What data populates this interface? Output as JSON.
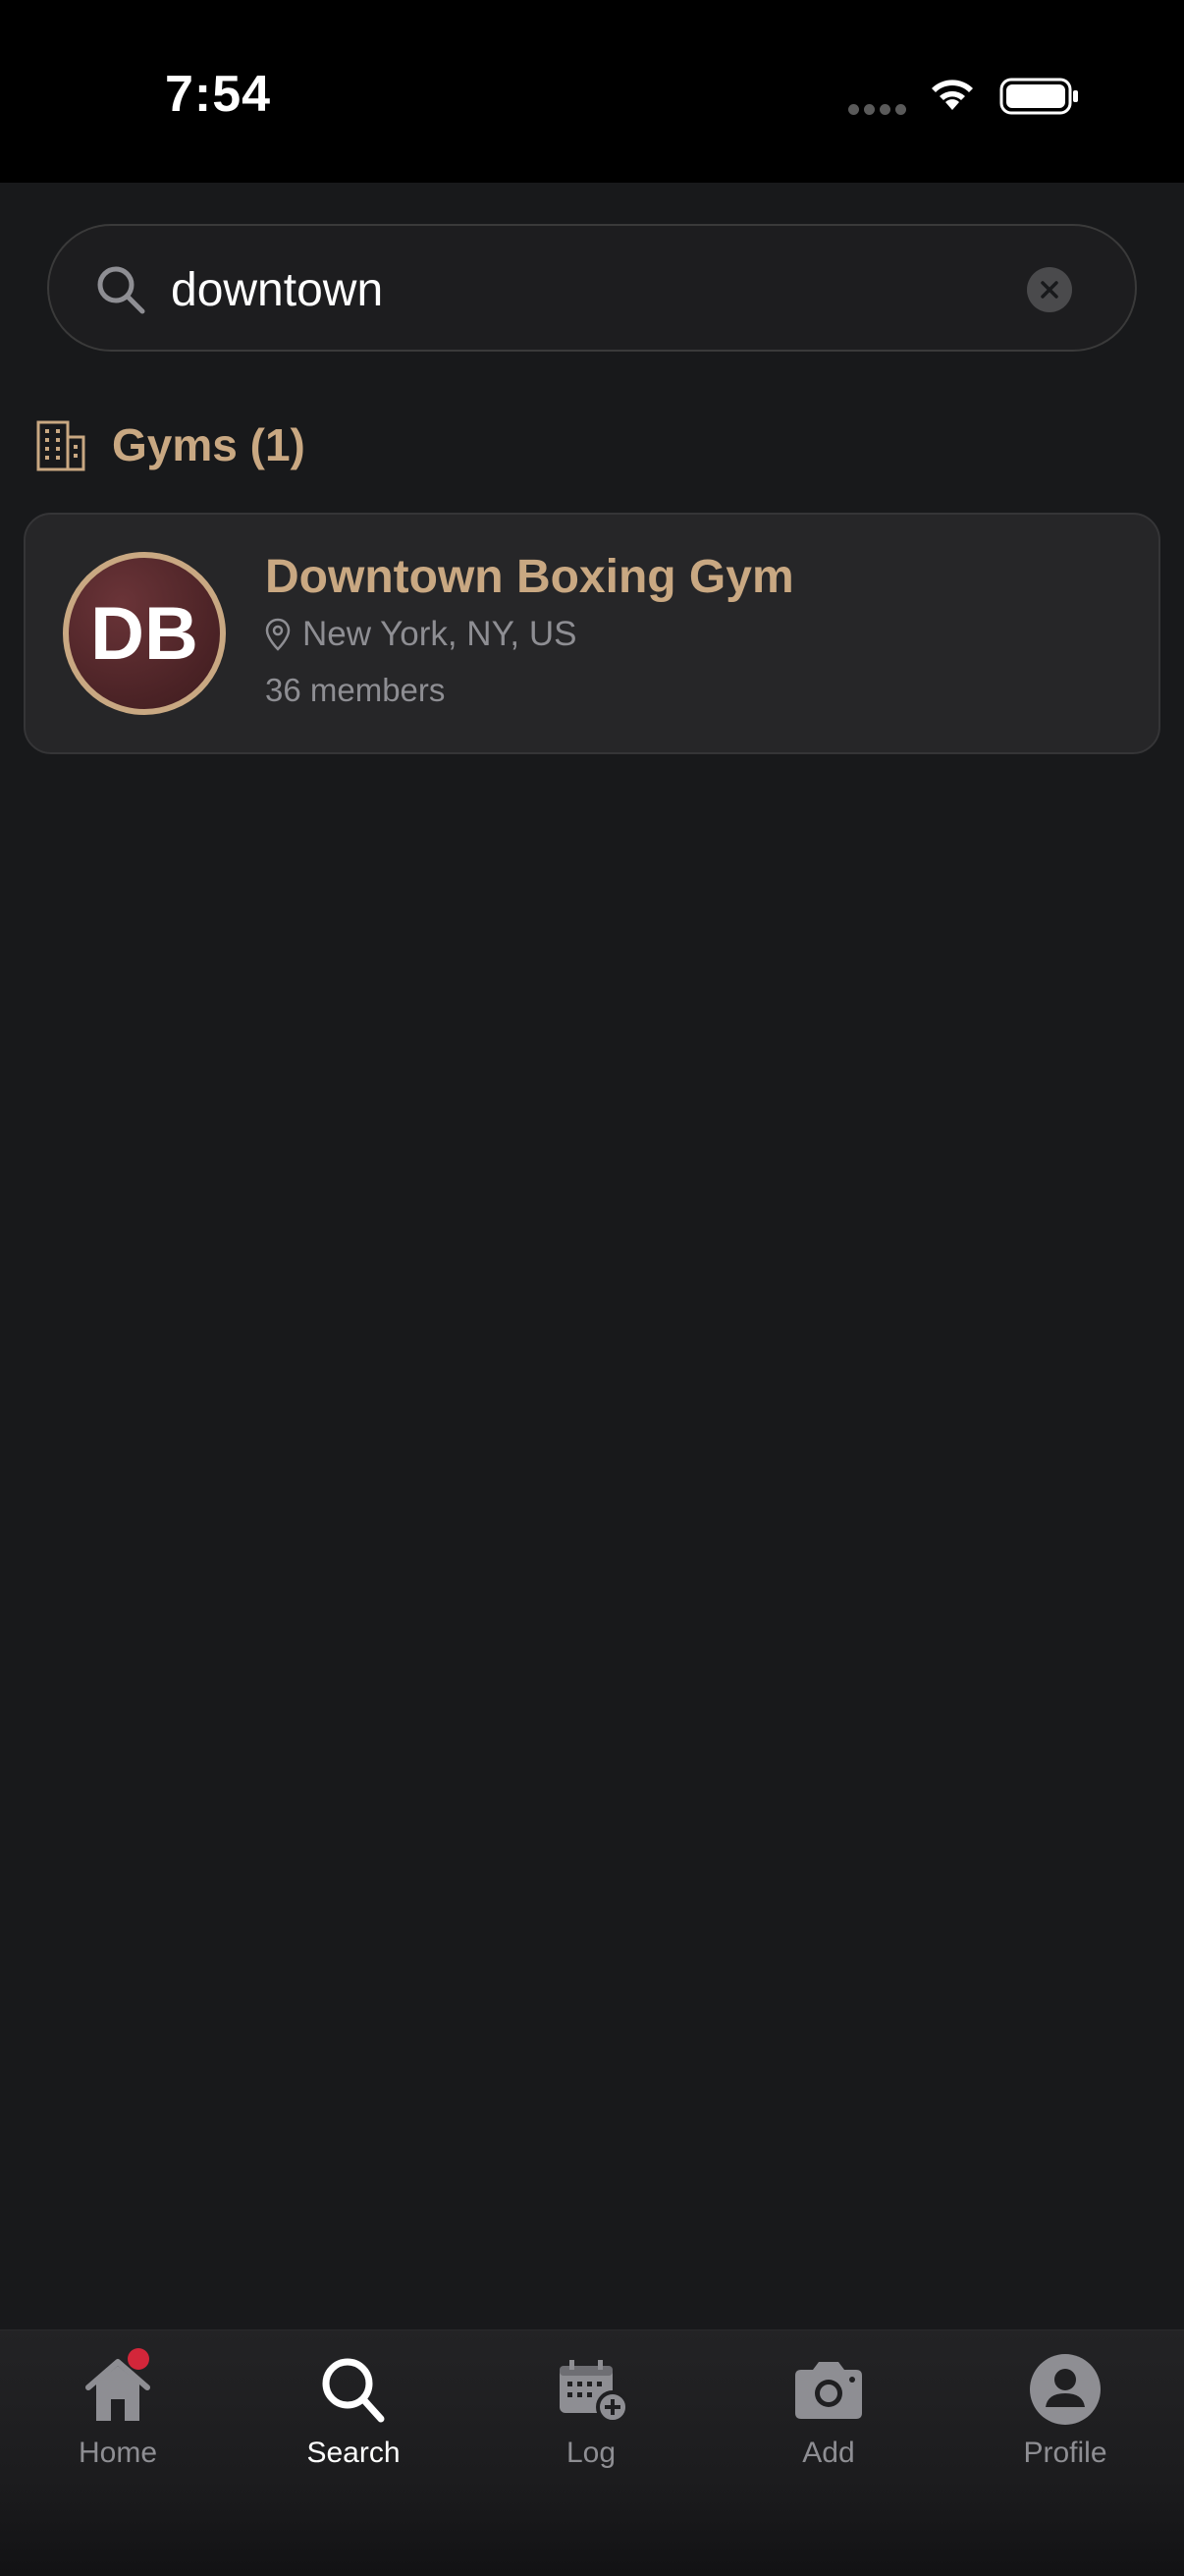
{
  "status_bar": {
    "time": "7:54"
  },
  "search": {
    "value": "downtown",
    "placeholder": ""
  },
  "results": {
    "section_title": "Gyms (1)",
    "gyms": [
      {
        "initials": "DB",
        "name": "Downtown Boxing Gym",
        "location": "New York, NY, US",
        "members": "36 members"
      }
    ]
  },
  "tab_bar": {
    "items": [
      {
        "label": "Home",
        "icon": "home-icon",
        "active": false,
        "badge": true
      },
      {
        "label": "Search",
        "icon": "search-icon",
        "active": true,
        "badge": false
      },
      {
        "label": "Log",
        "icon": "calendar-add-icon",
        "active": false,
        "badge": false
      },
      {
        "label": "Add",
        "icon": "camera-icon",
        "active": false,
        "badge": false
      },
      {
        "label": "Profile",
        "icon": "profile-icon",
        "active": false,
        "badge": false
      }
    ]
  },
  "colors": {
    "accent": "#c9a882",
    "background": "#18191b",
    "card": "#262628",
    "badge": "#d3263a"
  }
}
